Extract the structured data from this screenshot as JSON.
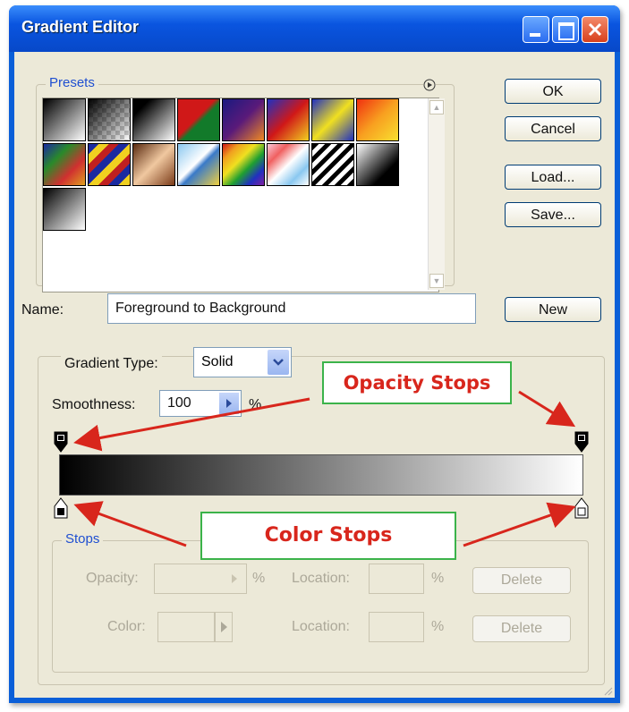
{
  "window": {
    "title": "Gradient Editor"
  },
  "presets": {
    "legend": "Presets"
  },
  "buttons": {
    "ok": "OK",
    "cancel": "Cancel",
    "load": "Load...",
    "save": "Save...",
    "new": "New"
  },
  "name_field": {
    "label": "Name:",
    "value": "Foreground to Background"
  },
  "gradient_type": {
    "label": "Gradient Type:",
    "value": "Solid"
  },
  "smoothness": {
    "label": "Smoothness:",
    "value": "100",
    "unit": "%"
  },
  "stops": {
    "legend": "Stops",
    "opacity_label": "Opacity:",
    "opacity_unit": "%",
    "color_label": "Color:",
    "location_label_1": "Location:",
    "location_unit_1": "%",
    "location_label_2": "Location:",
    "location_unit_2": "%",
    "delete_1": "Delete",
    "delete_2": "Delete"
  },
  "annotations": {
    "opacity_stops": "Opacity Stops",
    "color_stops": "Color Stops"
  },
  "colors": {
    "title_bar": "#0a55e0",
    "dialog_bg": "#ece9d8",
    "annotation_text": "#d8261c",
    "annotation_border": "#3bb34a",
    "arrow": "#d8261c"
  }
}
